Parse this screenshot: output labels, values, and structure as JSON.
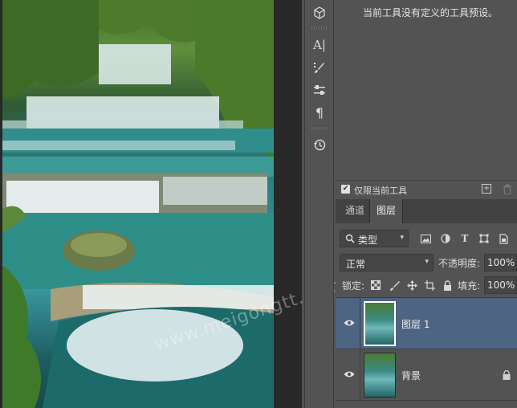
{
  "canvas": {
    "watermark": "www.meigongtt.com"
  },
  "toolbar": {
    "tools": [
      {
        "icon": "3d-cube-icon"
      },
      {
        "icon": "character-panel-icon",
        "glyph": "A|"
      },
      {
        "icon": "brush-settings-icon"
      },
      {
        "icon": "adjustments-icon"
      },
      {
        "icon": "paragraph-icon",
        "glyph": "¶"
      },
      {
        "icon": "history-icon"
      }
    ]
  },
  "tool_presets": {
    "empty_message": "当前工具没有定义的工具预设。",
    "current_tool_only_label": "仅限当前工具",
    "current_tool_only_checked": true
  },
  "layers_panel": {
    "tabs": [
      {
        "label": "通道",
        "active": false
      },
      {
        "label": "图层",
        "active": true
      }
    ],
    "filter": {
      "kind_label": "类型"
    },
    "blend_mode": "正常",
    "opacity_label": "不透明度:",
    "opacity_value": "100%",
    "lock_label": "锁定:",
    "fill_label": "填充:",
    "fill_value": "100%",
    "layers": [
      {
        "name": "图层 1",
        "visible": true,
        "selected": true,
        "locked": false
      },
      {
        "name": "背景",
        "visible": true,
        "selected": false,
        "locked": true
      }
    ]
  },
  "colors": {
    "selected_layer": "#4d6482",
    "panel_bg": "#535353",
    "tab_bar_bg": "#424242"
  }
}
